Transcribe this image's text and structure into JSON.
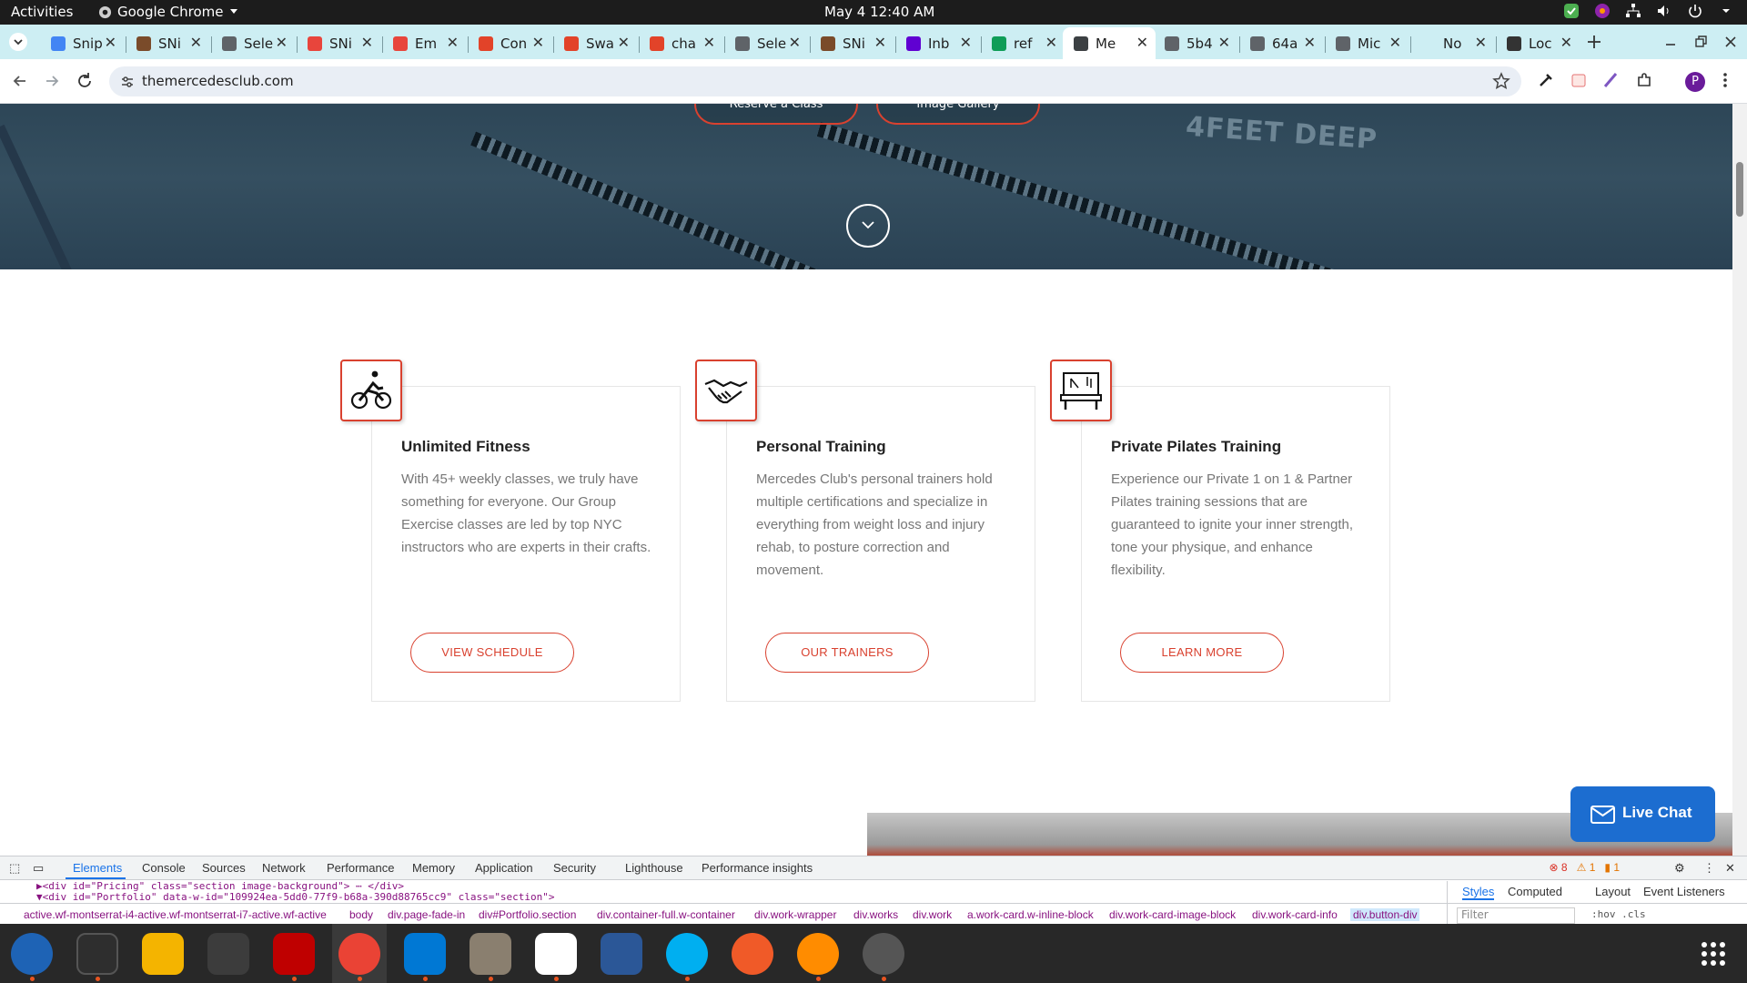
{
  "system": {
    "activities": "Activities",
    "app_name": "Google Chrome",
    "clock": "May 4  12:40 AM"
  },
  "browser": {
    "tabs": [
      {
        "label": "Snip",
        "color": "#4285f4"
      },
      {
        "label": "SNi",
        "color": "#7a4b2a"
      },
      {
        "label": "Sele",
        "color": "#5f6368"
      },
      {
        "label": "SNi",
        "color": "#e8453c"
      },
      {
        "label": "Em",
        "color": "#e8453c"
      },
      {
        "label": "Con",
        "color": "#e24329"
      },
      {
        "label": "Swa",
        "color": "#e24329"
      },
      {
        "label": "cha",
        "color": "#e24329"
      },
      {
        "label": "Sele",
        "color": "#5f6368"
      },
      {
        "label": "SNi",
        "color": "#7a4b2a"
      },
      {
        "label": "Inb",
        "color": "#6001d2"
      },
      {
        "label": "ref",
        "color": "#0f9d58"
      },
      {
        "label": "Me",
        "color": "#3c4043",
        "active": true
      },
      {
        "label": "5b4",
        "color": "#5f6368"
      },
      {
        "label": "64a",
        "color": "#5f6368"
      },
      {
        "label": "Mic",
        "color": "#5f6368"
      },
      {
        "label": "No",
        "color": "#cdeef3"
      },
      {
        "label": "Loc",
        "color": "#333333"
      }
    ],
    "url": "themercedesclub.com",
    "profile_initial": "P"
  },
  "page": {
    "hero": {
      "reserve_label": "Reserve a Class",
      "gallery_label": "Image Gallery",
      "pool_marking": "4FEET DEEP"
    },
    "cards": [
      {
        "icon": "bicycle-icon",
        "title": "Unlimited Fitness",
        "body": "With 45+ weekly classes, we truly have something for everyone. Our Group Exercise classes are led by top NYC instructors who are experts in their crafts.",
        "button": "VIEW SCHEDULE"
      },
      {
        "icon": "handshake-icon",
        "title": "Personal Training",
        "body": "Mercedes Club's personal trainers hold multiple certifications and specialize in everything from weight loss and injury rehab, to posture correction and movement.",
        "button": "OUR TRAINERS"
      },
      {
        "icon": "pilates-reformer-icon",
        "title": "Private Pilates Training",
        "body": "Experience our Private 1 on 1 & Partner Pilates training sessions that are guaranteed to ignite your inner strength, tone your physique, and enhance flexibility.",
        "button": "LEARN MORE"
      }
    ],
    "live_chat": "Live Chat",
    "accent": "#d9412f"
  },
  "devtools": {
    "tabs": [
      "Elements",
      "Console",
      "Sources",
      "Network",
      "Performance",
      "Memory",
      "Application",
      "Security",
      "Lighthouse",
      "Performance insights"
    ],
    "errors": "8",
    "warnings": "1",
    "issues": "1",
    "dom_lines": [
      "▶<div id=\"Pricing\" class=\"section image-background\"> ⋯ </div>",
      "▼<div id=\"Portfolio\" data-w-id=\"109924ea-5dd0-77f9-b68a-390d88765cc9\" class=\"section\">"
    ],
    "breadcrumbs": [
      "active.wf-montserrat-i4-active.wf-montserrat-i7-active.wf-active",
      "body",
      "div.page-fade-in",
      "div#Portfolio.section",
      "div.container-full.w-container",
      "div.work-wrapper",
      "div.works",
      "div.work",
      "a.work-card.w-inline-block",
      "div.work-card-image-block",
      "div.work-card-info",
      "div.button-div"
    ],
    "style_tabs": [
      "Styles",
      "Computed",
      "Layout",
      "Event Listeners"
    ],
    "filter_placeholder": "Filter",
    "hov_cls": ":hov  .cls"
  }
}
